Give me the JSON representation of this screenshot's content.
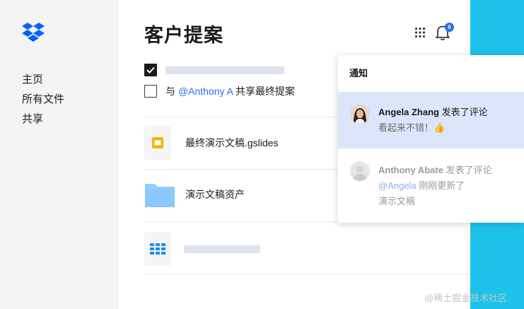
{
  "sidebar": {
    "logo": "dropbox-logo",
    "items": [
      {
        "label": "主页"
      },
      {
        "label": "所有文件"
      },
      {
        "label": "共享"
      }
    ]
  },
  "header": {
    "title": "客户提案",
    "notification_count": "6"
  },
  "tasks": [
    {
      "checked": true,
      "text": ""
    },
    {
      "checked": false,
      "prefix": "与 ",
      "mention": "@Anthony A",
      "suffix": " 共享最终提案"
    }
  ],
  "files": [
    {
      "icon": "slides-icon",
      "name": "最终演示文稿.gslides"
    },
    {
      "icon": "folder-icon",
      "name": "演示文稿资产"
    },
    {
      "icon": "grid-file-icon",
      "name": ""
    }
  ],
  "notifications": {
    "title": "通知",
    "items": [
      {
        "name": "Angela Zhang",
        "action": " 发表了评论",
        "message": "看起来不错！👍",
        "active": true
      },
      {
        "name": "Anthony Abate",
        "action": " 发表了评论",
        "mention": "@Angela",
        "message_line1": " 刚刚更新了",
        "message_line2": "演示文稿",
        "active": false
      }
    ]
  },
  "colors": {
    "accent": "#1dc3ea",
    "brand_blue": "#2d6bf0",
    "active_notification_bg": "#dbe6fa"
  },
  "watermark": "@稀土掘金技术社区"
}
